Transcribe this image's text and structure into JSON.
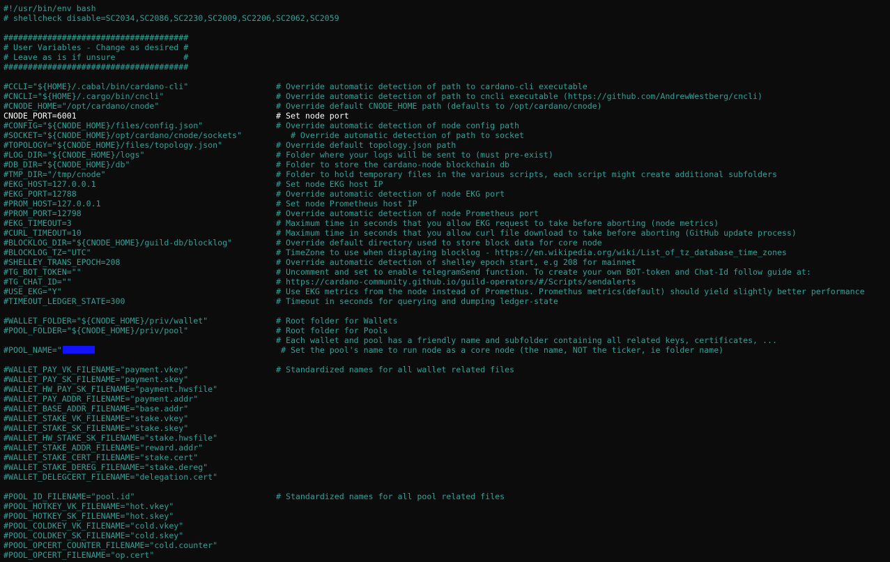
{
  "lines": [
    {
      "code": "#!/usr/bin/env bash",
      "comment": ""
    },
    {
      "code": "# shellcheck disable=SC2034,SC2086,SC2230,SC2009,SC2206,SC2062,SC2059",
      "comment": ""
    },
    {
      "code": "",
      "comment": ""
    },
    {
      "code": "######################################",
      "comment": ""
    },
    {
      "code": "# User Variables - Change as desired #",
      "comment": ""
    },
    {
      "code": "# Leave as is if unsure              #",
      "comment": ""
    },
    {
      "code": "######################################",
      "comment": ""
    },
    {
      "code": "",
      "comment": ""
    },
    {
      "code": "#CCLI=\"${HOME}/.cabal/bin/cardano-cli\"",
      "comment": "# Override automatic detection of path to cardano-cli executable"
    },
    {
      "code": "#CNCLI=\"${HOME}/.cargo/bin/cncli\"",
      "comment": "# Override automatic detection of path to cncli executable (https://github.com/AndrewWestberg/cncli)"
    },
    {
      "code": "#CNODE_HOME=\"/opt/cardano/cnode\"",
      "comment": "# Override default CNODE_HOME path (defaults to /opt/cardano/cnode)"
    },
    {
      "code": "CNODE_PORT=6001",
      "comment": "# Set node port"
    },
    {
      "code": "#CONFIG=\"${CNODE_HOME}/files/config.json\"",
      "comment": "# Override automatic detection of node config path"
    },
    {
      "code": "#SOCKET=\"${CNODE_HOME}/opt/cardano/cnode/sockets\"",
      "comment": "   # Override automatic detection of path to socket"
    },
    {
      "code": "#TOPOLOGY=\"${CNODE_HOME}/files/topology.json\"",
      "comment": "# Override default topology.json path"
    },
    {
      "code": "#LOG_DIR=\"${CNODE_HOME}/logs\"",
      "comment": "# Folder where your logs will be sent to (must pre-exist)"
    },
    {
      "code": "#DB_DIR=\"${CNODE_HOME}/db\"",
      "comment": "# Folder to store the cardano-node blockchain db"
    },
    {
      "code": "#TMP_DIR=\"/tmp/cnode\"",
      "comment": "# Folder to hold temporary files in the various scripts, each script might create additional subfolders"
    },
    {
      "code": "#EKG_HOST=127.0.0.1",
      "comment": "# Set node EKG host IP"
    },
    {
      "code": "#EKG_PORT=12788",
      "comment": "# Override automatic detection of node EKG port"
    },
    {
      "code": "#PROM_HOST=127.0.0.1",
      "comment": "# Set node Prometheus host IP"
    },
    {
      "code": "#PROM_PORT=12798",
      "comment": "# Override automatic detection of node Prometheus port"
    },
    {
      "code": "#EKG_TIMEOUT=3",
      "comment": "# Maximum time in seconds that you allow EKG request to take before aborting (node metrics)"
    },
    {
      "code": "#CURL_TIMEOUT=10",
      "comment": "# Maximum time in seconds that you allow curl file download to take before aborting (GitHub update process)"
    },
    {
      "code": "#BLOCKLOG_DIR=\"${CNODE_HOME}/guild-db/blocklog\"",
      "comment": "# Override default directory used to store block data for core node"
    },
    {
      "code": "#BLOCKLOG_TZ=\"UTC\"",
      "comment": "# TimeZone to use when displaying blocklog - https://en.wikipedia.org/wiki/List_of_tz_database_time_zones"
    },
    {
      "code": "#SHELLEY_TRANS_EPOCH=208",
      "comment": "# Override automatic detection of shelley epoch start, e.g 208 for mainnet"
    },
    {
      "code": "#TG_BOT_TOKEN=\"\"",
      "comment": "# Uncomment and set to enable telegramSend function. To create your own BOT-token and Chat-Id follow guide at:"
    },
    {
      "code": "#TG_CHAT_ID=\"\"",
      "comment": "# https://cardano-community.github.io/guild-operators/#/Scripts/sendalerts"
    },
    {
      "code": "#USE_EKG=\"Y\"",
      "comment": "# Use EKG metrics from the node instead of Promethus. Promethus metrics(default) should yield slightly better performance"
    },
    {
      "code": "#TIMEOUT_LEDGER_STATE=300",
      "comment": "# Timeout in seconds for querying and dumping ledger-state"
    },
    {
      "code": "",
      "comment": ""
    },
    {
      "code": "#WALLET_FOLDER=\"${CNODE_HOME}/priv/wallet\"",
      "comment": "# Root folder for Wallets"
    },
    {
      "code": "#POOL_FOLDER=\"${CNODE_HOME}/priv/pool\"",
      "comment": "# Root folder for Pools"
    },
    {
      "code": "",
      "comment": "# Each wallet and pool has a friendly name and subfolder containing all related keys, certificates, ..."
    },
    {
      "code": "#POOL_NAME=\"",
      "comment": " # Set the pool's name to run node as a core node (the name, NOT the ticker, ie folder name)",
      "redacted": true
    },
    {
      "code": "",
      "comment": ""
    },
    {
      "code": "#WALLET_PAY_VK_FILENAME=\"payment.vkey\"",
      "comment": "# Standardized names for all wallet related files"
    },
    {
      "code": "#WALLET_PAY_SK_FILENAME=\"payment.skey\"",
      "comment": ""
    },
    {
      "code": "#WALLET_HW_PAY_SK_FILENAME=\"payment.hwsfile\"",
      "comment": ""
    },
    {
      "code": "#WALLET_PAY_ADDR_FILENAME=\"payment.addr\"",
      "comment": ""
    },
    {
      "code": "#WALLET_BASE_ADDR_FILENAME=\"base.addr\"",
      "comment": ""
    },
    {
      "code": "#WALLET_STAKE_VK_FILENAME=\"stake.vkey\"",
      "comment": ""
    },
    {
      "code": "#WALLET_STAKE_SK_FILENAME=\"stake.skey\"",
      "comment": ""
    },
    {
      "code": "#WALLET_HW_STAKE_SK_FILENAME=\"stake.hwsfile\"",
      "comment": ""
    },
    {
      "code": "#WALLET_STAKE_ADDR_FILENAME=\"reward.addr\"",
      "comment": ""
    },
    {
      "code": "#WALLET_STAKE_CERT_FILENAME=\"stake.cert\"",
      "comment": ""
    },
    {
      "code": "#WALLET_STAKE_DEREG_FILENAME=\"stake.dereg\"",
      "comment": ""
    },
    {
      "code": "#WALLET_DELEGCERT_FILENAME=\"delegation.cert\"",
      "comment": ""
    },
    {
      "code": "",
      "comment": ""
    },
    {
      "code": "#POOL_ID_FILENAME=\"pool.id\"",
      "comment": "# Standardized names for all pool related files"
    },
    {
      "code": "#POOL_HOTKEY_VK_FILENAME=\"hot.vkey\"",
      "comment": ""
    },
    {
      "code": "#POOL_HOTKEY_SK_FILENAME=\"hot.skey\"",
      "comment": ""
    },
    {
      "code": "#POOL_COLDKEY_VK_FILENAME=\"cold.vkey\"",
      "comment": ""
    },
    {
      "code": "#POOL_COLDKEY_SK_FILENAME=\"cold.skey\"",
      "comment": ""
    },
    {
      "code": "#POOL_OPCERT_COUNTER_FILENAME=\"cold.counter\"",
      "comment": ""
    },
    {
      "code": "#POOL_OPCERT_FILENAME=\"op.cert\"",
      "comment": ""
    }
  ]
}
